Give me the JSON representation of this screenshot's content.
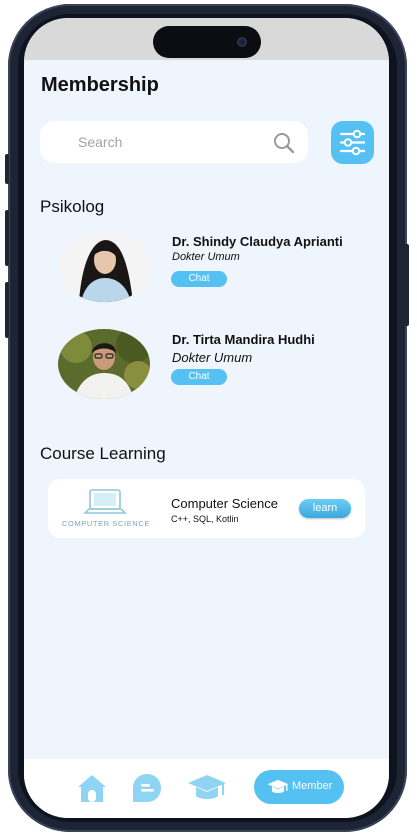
{
  "header": {
    "title": "Membership"
  },
  "search": {
    "placeholder": "Search"
  },
  "psikolog": {
    "title": "Psikolog",
    "doctors": [
      {
        "name": "Dr. Shindy Claudya Aprianti",
        "role": "Dokter Umum",
        "action": "Chat"
      },
      {
        "name": "Dr. Tirta Mandira Hudhi",
        "role": "Dokter Umum",
        "action": "Chat"
      }
    ]
  },
  "courses": {
    "title": "Course Learning",
    "items": [
      {
        "thumb_label": "COMPUTER SCIENCE",
        "title": "Computer Science",
        "subtitle": "C++, SQL, Kotlin",
        "action": "learn"
      }
    ]
  },
  "nav": {
    "items": [
      {
        "icon": "home-icon"
      },
      {
        "icon": "chat-icon"
      },
      {
        "icon": "graduation-cap-icon"
      },
      {
        "icon": "graduation-cap-icon",
        "label": "Member",
        "active": true
      }
    ]
  },
  "colors": {
    "accent": "#55c1f3",
    "background": "#eef5fd"
  }
}
